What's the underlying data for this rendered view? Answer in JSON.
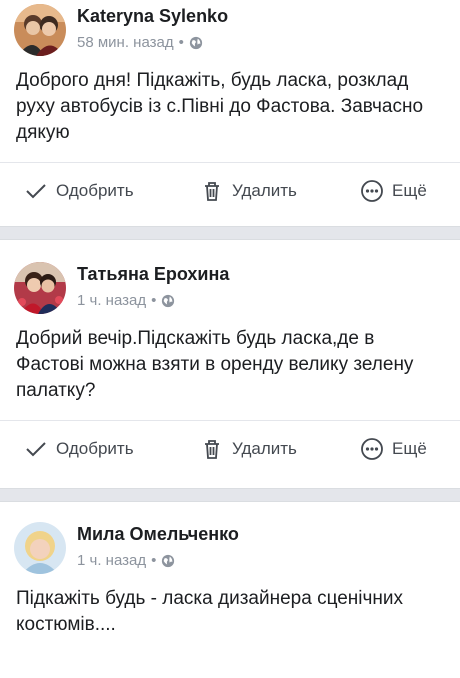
{
  "posts": [
    {
      "author": "Kateryna Sylenko",
      "time": "58 мин. назад",
      "text": "Доброго дня! Підкажіть, будь ласка, розклад руху автобусів із с.Півні до Фастова. Завчасно дякую"
    },
    {
      "author": "Татьяна Ерохина",
      "time": "1 ч. назад",
      "text": "Добрий вечір.Підскажіть будь ласка,де в Фастові можна взяти в оренду велику зелену палатку?"
    },
    {
      "author": "Мила Омельченко",
      "time": "1 ч. назад",
      "text": "Підкажіть будь - ласка дизайнера сценічних костюмів...."
    }
  ],
  "actions": {
    "approve": "Одобрить",
    "delete": "Удалить",
    "more": "Ещё"
  },
  "meta_separator": "•",
  "icons": {
    "approve": "check-icon",
    "delete": "trash-icon",
    "more": "more-dots-icon",
    "privacy": "globe-icon"
  },
  "colors": {
    "text": "#1c1e21",
    "meta": "#8d949e",
    "action": "#444950",
    "separator": "#e4e6eb"
  }
}
